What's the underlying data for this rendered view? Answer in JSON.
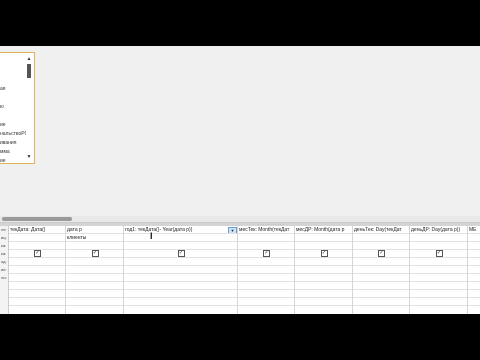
{
  "field_list": {
    "items": [
      "",
      "",
      "",
      "ая",
      "",
      "ю",
      "",
      "ие",
      "нальствоРС",
      "ивания",
      "мма",
      "ие"
    ],
    "scroll_up_icon": "triangle-up-icon",
    "scroll_down_icon": "triangle-down-icon"
  },
  "grid": {
    "row_labels": [
      "ле:",
      "иц:",
      "ка:",
      "ка:",
      "од:",
      "ие:",
      "ли:"
    ],
    "columns": [
      {
        "field": "текДата: Дата()",
        "table": "",
        "show": true
      },
      {
        "field": "дата р",
        "table": "клиенты",
        "show": true
      },
      {
        "field": "год1: текДата()- Year(дата р))",
        "table": "",
        "show": true,
        "has_dropdown": true
      },
      {
        "field": "месТек: Month(текДат",
        "table": "",
        "show": true
      },
      {
        "field": "месДР: Month(дата р",
        "table": "",
        "show": true
      },
      {
        "field": "деньТек: Day(текДат",
        "table": "",
        "show": true
      },
      {
        "field": "деньДР: Day(дата р))",
        "table": "",
        "show": true
      },
      {
        "field": "МЕ",
        "table": "",
        "show": false
      }
    ]
  },
  "icons": {
    "checkbox_checked": "✓",
    "dropdown": "▼"
  }
}
